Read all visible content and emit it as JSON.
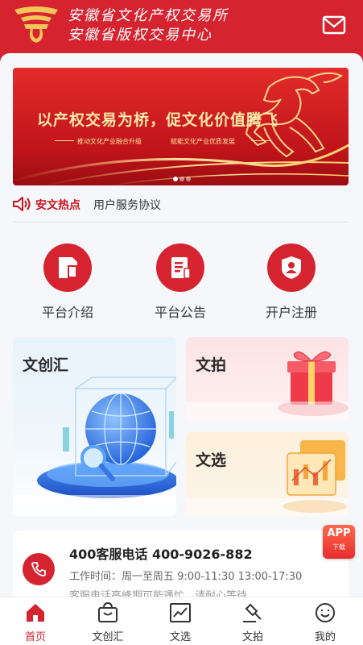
{
  "header": {
    "org_name_1": "安徽省文化产权交易所",
    "org_name_2": "安徽省版权交易中心",
    "brand_color": "#d5232f"
  },
  "banner": {
    "slogan": "以产权交易为桥，促文化价值腾飞",
    "sub_1": "推动文化产业融合升级",
    "sub_2": "赋能文化产业优质发展",
    "slides": 3,
    "active_slide": 1
  },
  "hot": {
    "label": "安文热点",
    "link": "用户服务协议"
  },
  "quick_links": [
    {
      "label": "平台介绍",
      "icon": "document-icon"
    },
    {
      "label": "平台公告",
      "icon": "notice-icon"
    },
    {
      "label": "开户注册",
      "icon": "user-shield-icon"
    }
  ],
  "cards": {
    "wenchuang": "文创汇",
    "wenpai": "文拍",
    "wenxuan": "文选"
  },
  "service": {
    "title": "400客服电话 400-9026-882",
    "hours": "工作时间：周一至周五 9:00-11:30 13:00-17:30",
    "note": "客服电话高峰期可能遇忙，请耐心等待"
  },
  "app_badge": {
    "title": "APP",
    "sub": "下载"
  },
  "tabs": [
    {
      "label": "首页",
      "icon": "home-icon",
      "active": true
    },
    {
      "label": "文创汇",
      "icon": "shopping-bag-icon",
      "active": false
    },
    {
      "label": "文选",
      "icon": "chart-icon",
      "active": false
    },
    {
      "label": "文拍",
      "icon": "gavel-icon",
      "active": false
    },
    {
      "label": "我的",
      "icon": "smile-icon",
      "active": false
    }
  ]
}
